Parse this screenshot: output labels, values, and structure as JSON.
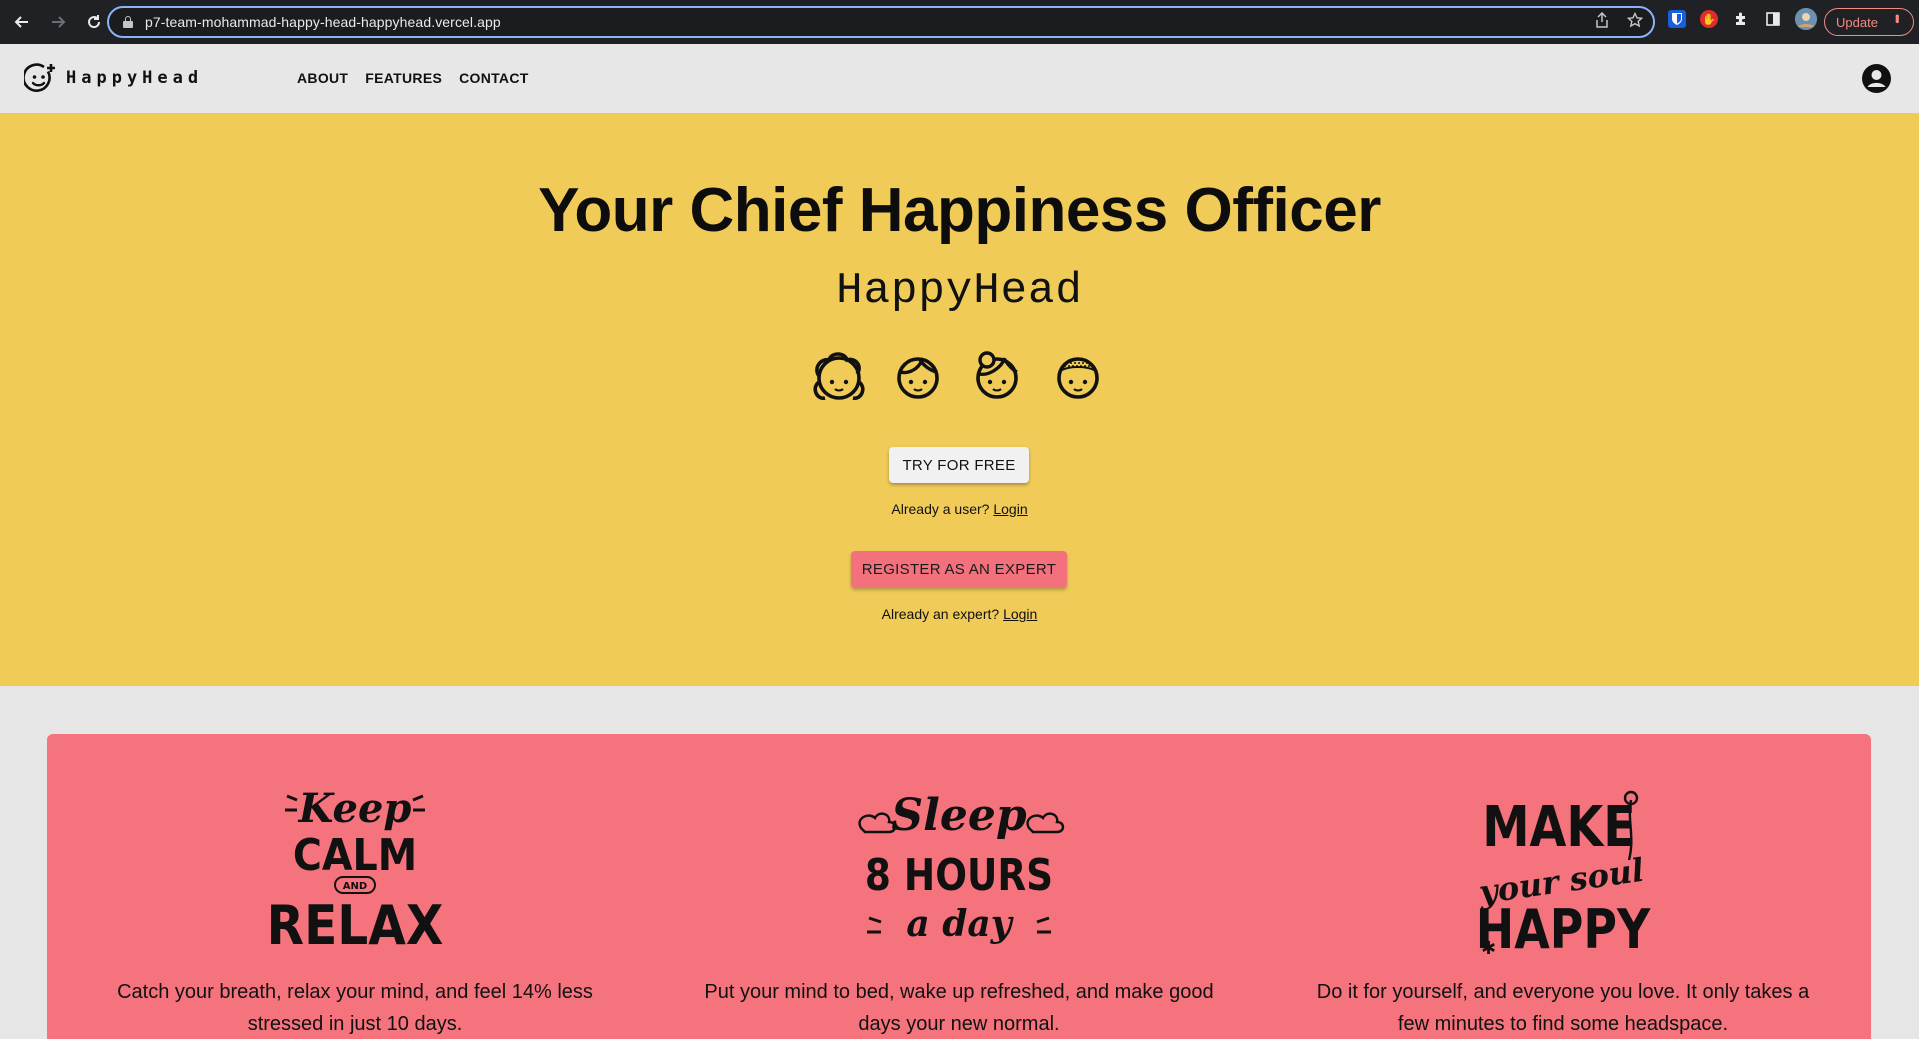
{
  "browser": {
    "url": "p7-team-mohammad-happy-head-happyhead.vercel.app",
    "update_label": "Update",
    "icons": [
      "back-icon",
      "forward-icon",
      "reload-icon",
      "lock-icon",
      "share-icon",
      "star-icon",
      "bitwarden-icon",
      "extension-red-icon",
      "puzzle-icon",
      "sidepanel-icon",
      "profile-avatar"
    ]
  },
  "nav": {
    "brand": "HappyHead",
    "links": [
      "ABOUT",
      "FEATURES",
      "CONTACT"
    ]
  },
  "hero": {
    "title": "Your Chief Happiness Officer",
    "subtitle": "HappyHead",
    "try_button": "TRY FOR FREE",
    "user_prompt": "Already a user?",
    "user_login": "Login",
    "expert_button": "REGISTER AS AN EXPERT",
    "expert_prompt": "Already an expert?",
    "expert_login": "Login"
  },
  "features": [
    {
      "art_lines": [
        "Keep",
        "CALM",
        "AND",
        "RELAX"
      ],
      "text": "Catch your breath, relax your mind, and feel 14% less stressed in just 10 days."
    },
    {
      "art_lines": [
        "Sleep",
        "8 HOURS",
        "a day"
      ],
      "text": "Put your mind to bed, wake up refreshed, and make good days your new normal."
    },
    {
      "art_lines": [
        "MAKE",
        "your soul",
        "HAPPY"
      ],
      "text": "Do it for yourself, and everyone you love. It only takes a few minutes to find some headspace."
    }
  ],
  "colors": {
    "hero_bg": "#f0cb58",
    "features_bg": "#f4737c",
    "nav_bg": "#e7e7e7"
  }
}
